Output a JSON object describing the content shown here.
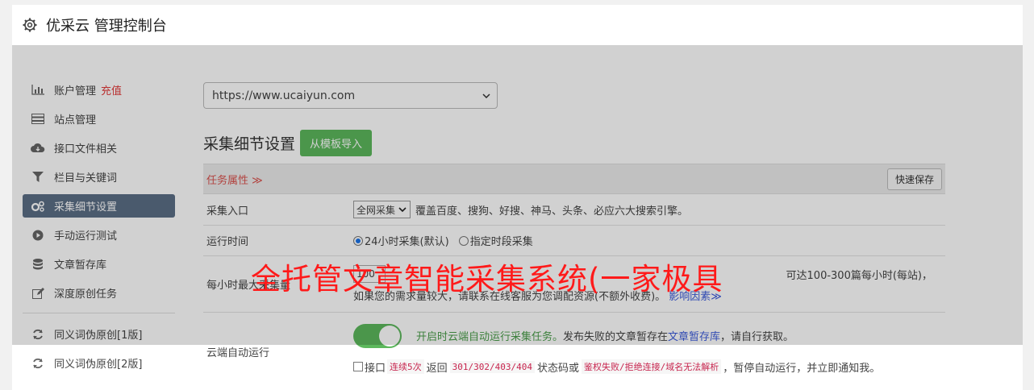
{
  "header": {
    "title": "优采云 管理控制台",
    "icon": "gear-icon"
  },
  "sidebar": {
    "items": [
      {
        "label": "账户管理",
        "extra": "充值",
        "icon": "bar-chart-icon"
      },
      {
        "label": "站点管理",
        "icon": "server-icon"
      },
      {
        "label": "接口文件相关",
        "icon": "cloud-download-icon"
      },
      {
        "label": "栏目与关键词",
        "icon": "filter-icon"
      },
      {
        "label": "采集细节设置",
        "icon": "cogs-icon",
        "active": true
      },
      {
        "label": "手动运行测试",
        "icon": "play-icon"
      },
      {
        "label": "文章暂存库",
        "icon": "database-icon"
      },
      {
        "label": "深度原创任务",
        "icon": "edit-icon"
      },
      {
        "label": "同义词伪原创[1版]",
        "icon": "refresh-icon"
      },
      {
        "label": "同义词伪原创[2版]",
        "icon": "refresh-icon"
      }
    ]
  },
  "main": {
    "site_select": "https://www.ucaiyun.com",
    "section_title": "采集细节设置",
    "import_button": "从模板导入",
    "props_label": "任务属性 ≫",
    "quick_save": "快速保存",
    "rows": {
      "entry": {
        "label": "采集入口",
        "select": "全网采集",
        "desc": "覆盖百度、搜狗、好搜、神马、头条、必应六大搜索引擎。"
      },
      "runtime": {
        "label": "运行时间",
        "opt1": "24小时采集(默认)",
        "opt2": "指定时段采集"
      },
      "max_per_hour": {
        "label": "每小时最大采集量",
        "value": "100",
        "line1_tail": "可达100-300篇每小时(每站)，",
        "line2": "如果您的需求量较大，请联系在线客服为您调配资源(不额外收费)。",
        "link": "影响因素≫"
      },
      "cloud_auto": {
        "label": "云端自动运行",
        "desc_green": "开启时云端自动运行采集任务。",
        "desc_rest": "发布失败的文章暂存在",
        "desc_link": "文章暂存库",
        "desc_tail": "，请自行获取。",
        "chk_label": "接口",
        "code1": "连续5次",
        "text_return": "返回",
        "code2": "301/302/403/404",
        "text_status": "状态码或",
        "code3": "鉴权失败/拒绝连接/域名无法解析",
        "text_end": "，暂停自动运行，并立即通知我。"
      }
    }
  },
  "banner": "全托管文章智能采集系统(一家极具"
}
